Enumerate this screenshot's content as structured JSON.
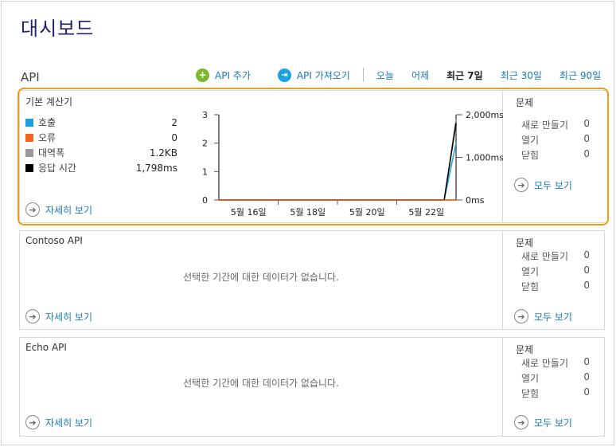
{
  "page": {
    "title": "대시보드"
  },
  "section": {
    "title": "API"
  },
  "toolbar": {
    "add_api": "API 추가",
    "import_api": "API 가져오기",
    "ranges": [
      "오늘",
      "어제",
      "최근 7일",
      "최근 30일",
      "최근 90일"
    ],
    "active_range": "최근 7일"
  },
  "colors": {
    "accent": "#1a7ab7",
    "highlight": "#f39c12",
    "calls": "#1ba1e2",
    "errors": "#f26522",
    "bandwidth": "#999999",
    "response": "#000000"
  },
  "cards": [
    {
      "name": "기본 계산기",
      "metrics": [
        {
          "label": "호출",
          "value": "2",
          "color": "#1ba1e2"
        },
        {
          "label": "오류",
          "value": "0",
          "color": "#f26522"
        },
        {
          "label": "대역폭",
          "value": "1.2KB",
          "color": "#999999"
        },
        {
          "label": "응답 시간",
          "value": "1,798ms",
          "color": "#000000"
        }
      ],
      "more": "자세히 보기",
      "issues": {
        "title": "문제",
        "rows": [
          {
            "label": "새로 만들기",
            "value": "0"
          },
          {
            "label": "열기",
            "value": "0"
          },
          {
            "label": "닫힘",
            "value": "0"
          }
        ],
        "more": "모두 보기"
      }
    },
    {
      "name": "Contoso API",
      "empty": "선택한 기간에 대한 데이터가 없습니다.",
      "more": "자세히 보기",
      "issues": {
        "title": "문제",
        "rows": [
          {
            "label": "새로 만들기",
            "value": "0"
          },
          {
            "label": "열기",
            "value": "0"
          },
          {
            "label": "닫힘",
            "value": "0"
          }
        ],
        "more": "모두 보기"
      }
    },
    {
      "name": "Echo API",
      "empty": "선택한 기간에 대한 데이터가 없습니다.",
      "more": "자세히 보기",
      "issues": {
        "title": "문제",
        "rows": [
          {
            "label": "새로 만들기",
            "value": "0"
          },
          {
            "label": "열기",
            "value": "0"
          },
          {
            "label": "닫힘",
            "value": "0"
          }
        ],
        "more": "모두 보기"
      }
    }
  ],
  "chart_data": {
    "type": "line",
    "x_tick_labels": [
      "5월 16일",
      "5월 18일",
      "5월 20일",
      "5월 22일"
    ],
    "left_axis": {
      "ticks": [
        "0",
        "1",
        "2",
        "3"
      ],
      "range": [
        0,
        3
      ]
    },
    "right_axis": {
      "ticks": [
        "0ms",
        "1,000ms",
        "2,000ms"
      ],
      "range": [
        0,
        2000
      ]
    },
    "series": [
      {
        "axis": "right",
        "color": "#999999",
        "points": [
          [
            0.0,
            0
          ],
          [
            0.95,
            0
          ],
          [
            1.0,
            1900
          ]
        ]
      },
      {
        "axis": "left",
        "color": "#1ba1e2",
        "points": [
          [
            0.0,
            0
          ],
          [
            0.95,
            0
          ],
          [
            1.0,
            2
          ]
        ]
      },
      {
        "axis": "right",
        "color": "#000000",
        "points": [
          [
            0.0,
            0
          ],
          [
            0.95,
            0
          ],
          [
            1.0,
            1798
          ]
        ]
      },
      {
        "axis": "left",
        "color": "#f26522",
        "points": [
          [
            0.0,
            0
          ],
          [
            1.0,
            0
          ]
        ]
      }
    ]
  }
}
